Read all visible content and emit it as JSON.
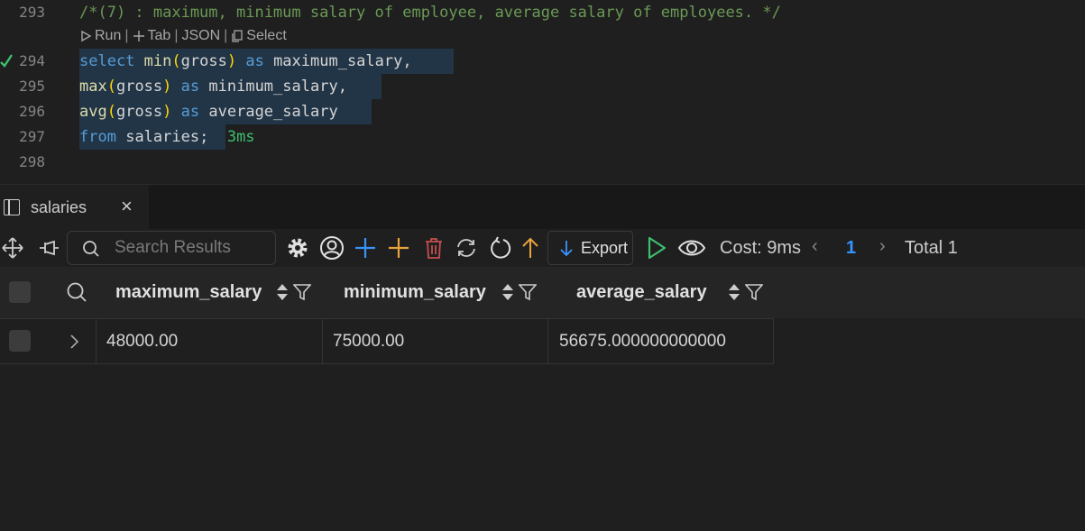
{
  "editor": {
    "lines": [
      {
        "num": "293"
      },
      {
        "num": "294"
      },
      {
        "num": "295"
      },
      {
        "num": "296"
      },
      {
        "num": "297"
      },
      {
        "num": "298"
      }
    ],
    "comment": "/*(7) : maximum, minimum salary of employee, average salary of employees. */",
    "codelens": {
      "run": "Run",
      "tab": "Tab",
      "json": "JSON",
      "select": "Select"
    },
    "tokens": {
      "select": "select",
      "min": "min",
      "max": "max",
      "avg": "avg",
      "open": "(",
      "close": ")",
      "gross": "gross",
      "as": "as",
      "comma": ",",
      "maximum_salary": "maximum_salary",
      "minimum_salary": "minimum_salary",
      "average_salary": "average_salary",
      "from": "from",
      "salaries": "salaries",
      "semi": ";"
    },
    "exec_time": "3ms"
  },
  "result_tab": {
    "label": "salaries",
    "close": "×"
  },
  "toolbar": {
    "search_placeholder": "Search Results",
    "export_label": "Export",
    "cost": "Cost: 9ms",
    "page": "1",
    "total": "Total 1",
    "prev": "‹",
    "next": "›"
  },
  "grid": {
    "columns": [
      "maximum_salary",
      "minimum_salary",
      "average_salary"
    ],
    "rows": [
      [
        "48000.00",
        "75000.00",
        "56675.000000000000"
      ]
    ]
  },
  "colors": {
    "accent": "#3794ff",
    "run_green": "#3dbf6e",
    "add_orange": "#e8a33d",
    "delete_red": "#c74e4e"
  }
}
